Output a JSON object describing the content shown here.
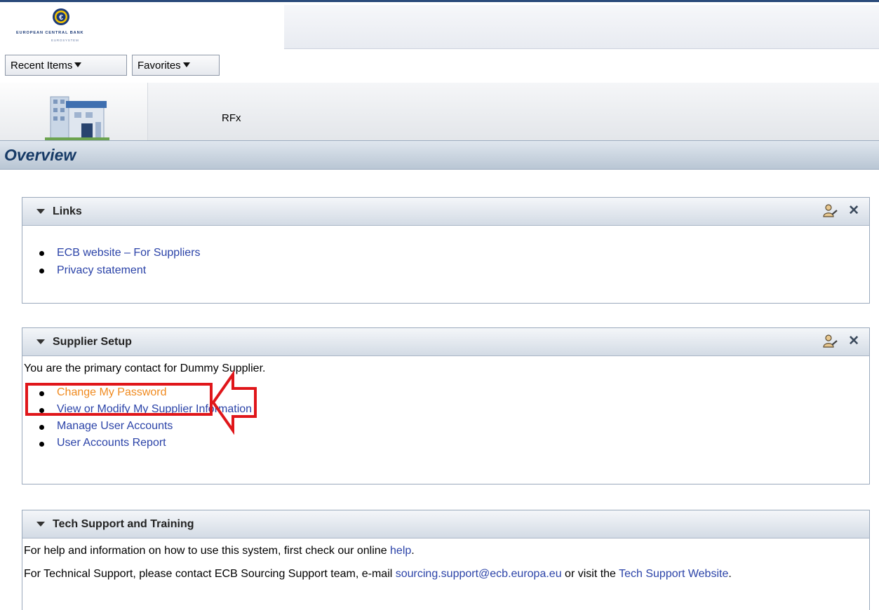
{
  "header": {
    "logo_name": "EUROPEAN CENTRAL BANK",
    "logo_sub": "EUROSYSTEM"
  },
  "nav": {
    "recent_items": "Recent Items",
    "favorites": "Favorites"
  },
  "tabs": {
    "rfx": "RFx"
  },
  "page_title": "Overview",
  "portlets": {
    "links": {
      "title": "Links",
      "items": [
        "ECB website – For Suppliers",
        "Privacy statement"
      ]
    },
    "supplier_setup": {
      "title": "Supplier Setup",
      "intro": "You are the primary contact for Dummy Supplier.",
      "items": [
        "Change My Password",
        "View or Modify My Supplier Information",
        "Manage User Accounts",
        "User Accounts Report"
      ]
    },
    "tech_support": {
      "title": "Tech Support and Training",
      "line1_text": "For help and information on how to use this system, first check our online ",
      "line1_link": "help",
      "line1_end": ".",
      "line2_text": "For Technical Support, please contact ECB Sourcing Support team, e-mail ",
      "line2_email": "sourcing.support@ecb.europa.eu",
      "line2_mid": " or visit the ",
      "line2_link": "Tech Support Website",
      "line2_end": "."
    }
  },
  "icons": {
    "edit": "user-edit-icon",
    "close": "close-icon",
    "collapse": "triangle-down-icon"
  },
  "colors": {
    "link": "#2b43a8",
    "visited_link": "#f08a1f",
    "highlight": "#e0161a",
    "title": "#163a66"
  }
}
